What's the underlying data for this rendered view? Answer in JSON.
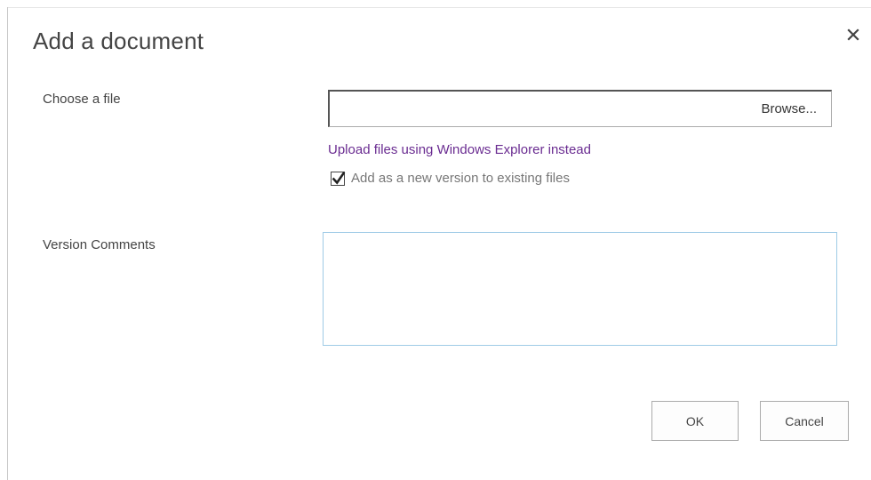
{
  "dialog": {
    "title": "Add a document",
    "close_icon": "close-icon"
  },
  "file": {
    "label": "Choose a file",
    "value": "",
    "browse_label": "Browse..."
  },
  "upload_link": {
    "label": "Upload files using Windows Explorer instead"
  },
  "version_option": {
    "label": "Add as a new version to existing files",
    "checked": true
  },
  "comments": {
    "label": "Version Comments",
    "value": ""
  },
  "actions": {
    "ok_label": "OK",
    "cancel_label": "Cancel"
  },
  "colors": {
    "link": "#6a2c91",
    "textarea_border": "#9fcbe6",
    "text": "#444444"
  }
}
